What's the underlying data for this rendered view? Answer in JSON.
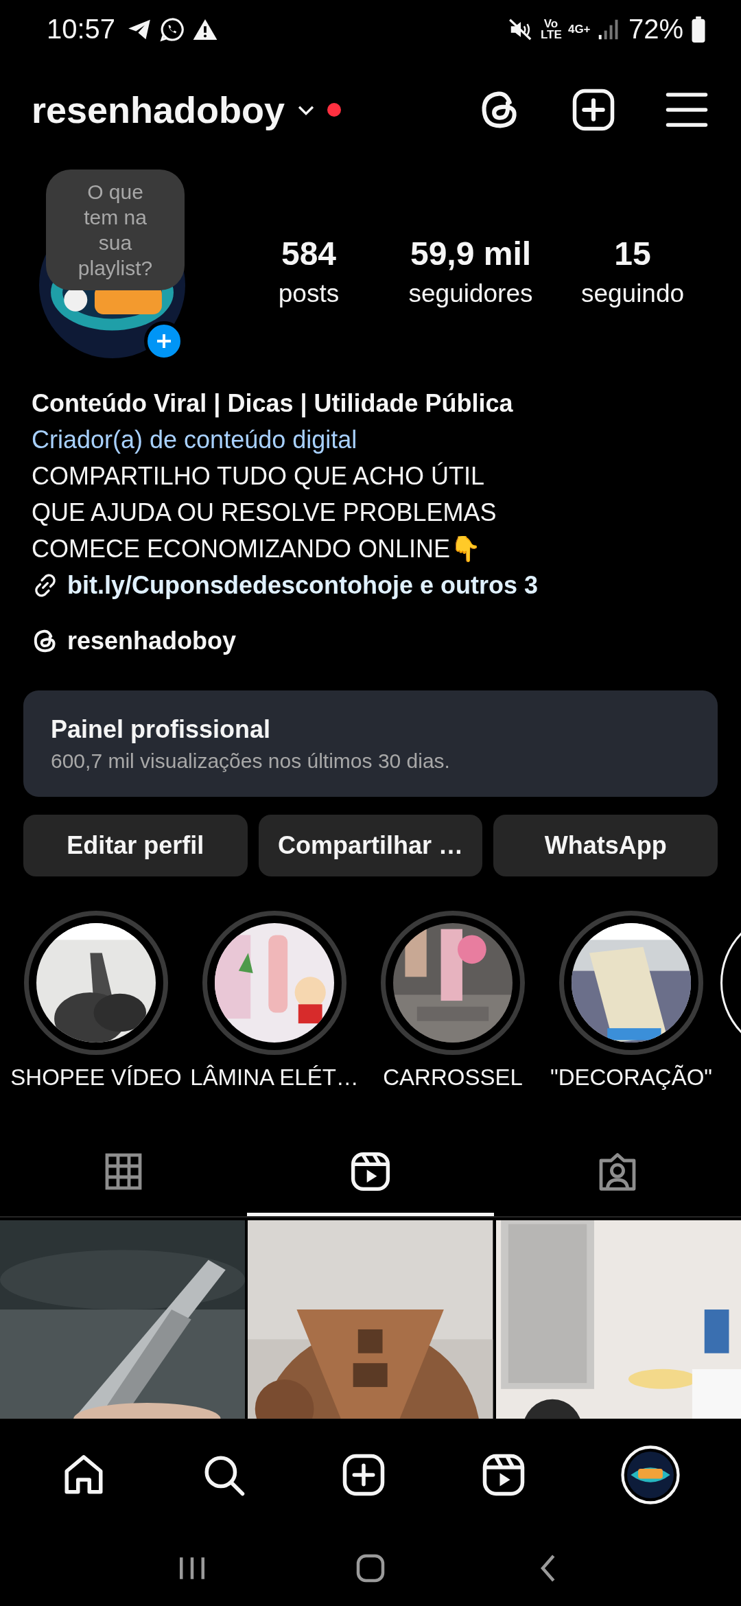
{
  "status_bar": {
    "time": "10:57",
    "volte": "Vo LTE",
    "network": "4G+",
    "battery": "72%"
  },
  "header": {
    "username": "resenhadoboy",
    "notification_dot": true
  },
  "profile": {
    "note": "O que tem na sua playlist?",
    "stats": [
      {
        "value": "584",
        "label": "posts"
      },
      {
        "value": "59,9 mil",
        "label": "seguidores"
      },
      {
        "value": "15",
        "label": "seguindo"
      }
    ]
  },
  "bio": {
    "title": "Conteúdo Viral | Dicas | Utilidade Pública",
    "category": "Criador(a) de conteúdo digital",
    "lines": [
      "COMPARTILHO TUDO QUE ACHO ÚTIL",
      "QUE AJUDA OU RESOLVE PROBLEMAS",
      "COMECE ECONOMIZANDO ONLINE👇"
    ],
    "link": "bit.ly/Cuponsdedescontohoje e outros 3",
    "threads": "resenhadoboy"
  },
  "dashboard": {
    "title": "Painel profissional",
    "subtitle": "600,7 mil visualizações nos últimos 30 dias."
  },
  "buttons": [
    "Editar perfil",
    "Compartilhar …",
    "WhatsApp"
  ],
  "highlights": [
    {
      "kind": "story",
      "label": "SHOPEE VÍDEO"
    },
    {
      "kind": "story",
      "label": "LÂMINA ELÉT…"
    },
    {
      "kind": "story",
      "label": "CARROSSEL"
    },
    {
      "kind": "story",
      "label": "\"DECORAÇÃO\""
    },
    {
      "kind": "new"
    }
  ],
  "tabs": [
    {
      "kind": "grid",
      "selected": false
    },
    {
      "kind": "reels",
      "selected": true
    },
    {
      "kind": "tagged",
      "selected": false
    }
  ],
  "bottom_nav": [
    {
      "kind": "home"
    },
    {
      "kind": "search"
    },
    {
      "kind": "create"
    },
    {
      "kind": "reels"
    },
    {
      "kind": "profile"
    }
  ]
}
